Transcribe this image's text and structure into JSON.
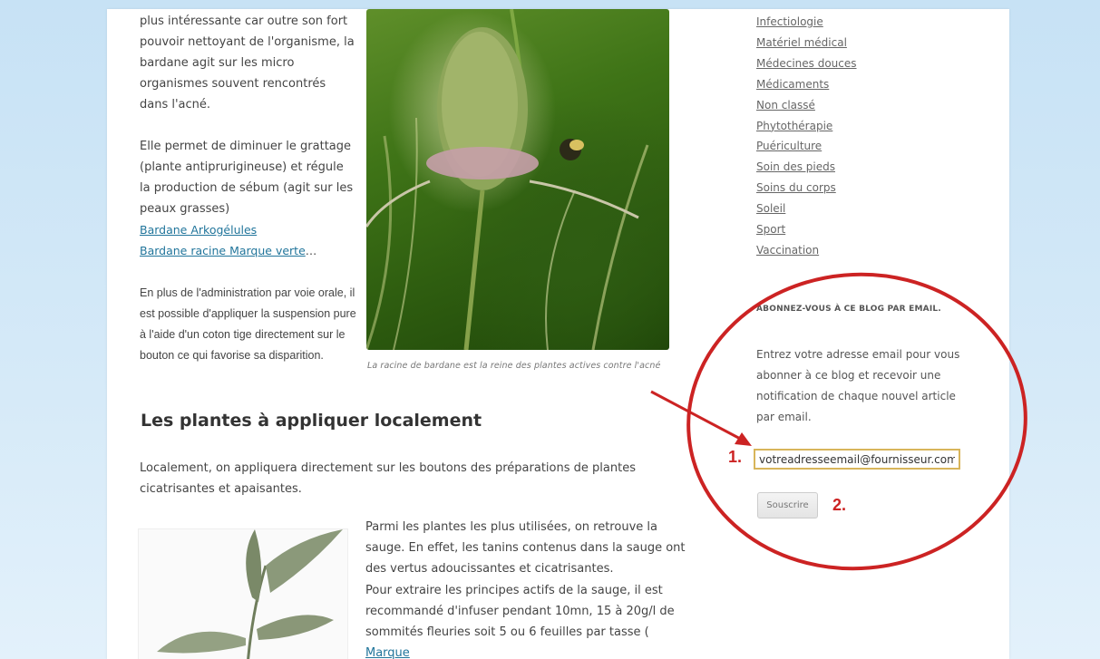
{
  "article": {
    "para1": "plus intéressante car outre son fort pouvoir nettoyant de l'organisme, la bardane agit sur les micro organismes souvent rencontrés dans l'acné.",
    "para2": "Elle permet de diminuer le grattage (plante antiprurigineuse) et régule la production de sébum (agit sur les peaux grasses)",
    "link1": "Bardane Arkogélules",
    "link2": "Bardane racine Marque verte",
    "link2_suffix": "…",
    "para3": "En plus de l'administration par voie orale, il est possible d'appliquer la suspension pure à l'aide d'un coton tige directement sur le bouton ce qui favorise sa disparition.",
    "image_caption": "La racine de bardane est la reine des plantes actives contre l'acné",
    "heading": "Les plantes à appliquer localement",
    "para4": "Localement, on appliquera directement sur les boutons des préparations de plantes cicatrisantes et apaisantes.",
    "para5": "Parmi les plantes les plus utilisées, on retrouve la sauge. En effet, les tanins contenus dans la sauge ont des vertus adoucissantes et cicatrisantes.",
    "para6": "Pour extraire les principes actifs de la sauge, il est recommandé d'infuser pendant 10mn, 15 à 20g/l de sommités fleuries soit 5 ou 6 feuilles par tasse (",
    "para6_link": "Marque"
  },
  "sidebar": {
    "categories": [
      "Infectiologie",
      "Matériel médical",
      "Médecines douces",
      "Médicaments",
      "Non classé",
      "Phytothérapie",
      "Puériculture",
      "Soin des pieds",
      "Soins du corps",
      "Soleil",
      "Sport",
      "Vaccination"
    ],
    "subscribe_widget": {
      "title": "ABONNEZ-VOUS À CE BLOG PAR EMAIL.",
      "description": "Entrez votre adresse email pour vous abonner à ce blog et recevoir une notification de chaque nouvel article par email.",
      "email_value": "votreadresseemail@fournisseur.com",
      "button_label": "Souscrire"
    }
  },
  "annotations": {
    "step1": "1.",
    "step2": "2.",
    "color": "#cc2323"
  }
}
